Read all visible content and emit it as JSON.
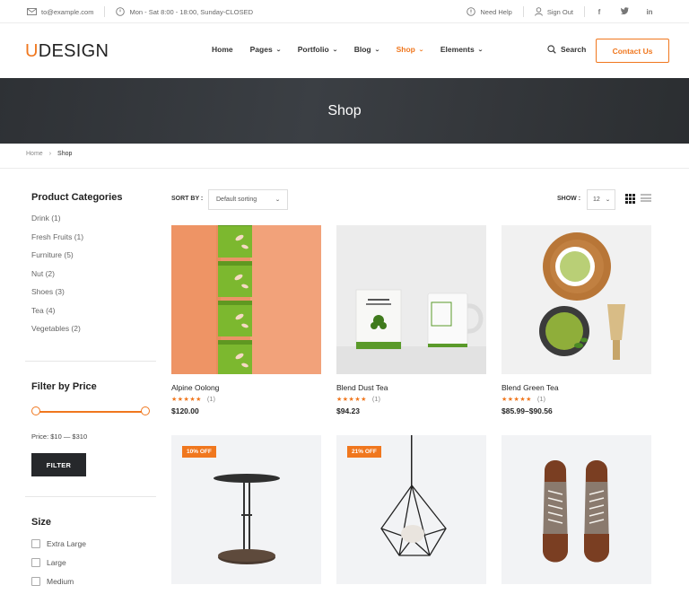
{
  "topbar": {
    "email": "to@example.com",
    "hours": "Mon - Sat 8:00 - 18:00, Sunday-CLOSED",
    "need_help": "Need Help",
    "sign_out": "Sign Out",
    "social": [
      "f",
      "t",
      "in"
    ]
  },
  "header": {
    "logo_u": "U",
    "logo_rest": "DESIGN",
    "nav": [
      "Home",
      "Pages",
      "Portfolio",
      "Blog",
      "Shop",
      "Elements"
    ],
    "search_label": "Search",
    "contact_label": "Contact Us"
  },
  "banner": {
    "title": "Shop"
  },
  "breadcrumb": {
    "home": "Home",
    "current": "Shop"
  },
  "sidebar": {
    "categories_title": "Product Categories",
    "categories": [
      "Drink (1)",
      "Fresh Fruits (1)",
      "Furniture (5)",
      "Nut (2)",
      "Shoes (3)",
      "Tea (4)",
      "Vegetables (2)"
    ],
    "price_title": "Filter by Price",
    "price_range": "Price: $10 — $310",
    "filter_label": "FILTER",
    "size_title": "Size",
    "sizes": [
      "Extra Large",
      "Large",
      "Medium"
    ]
  },
  "toolbar": {
    "sort_label": "SORT BY :",
    "sort_value": "Default sorting",
    "show_label": "SHOW :",
    "show_value": "12"
  },
  "products": [
    {
      "name": "Alpine Oolong",
      "stars": "★★★★★",
      "reviews": "(1)",
      "price": "$120.00"
    },
    {
      "name": "Blend Dust Tea",
      "stars": "★★★★★",
      "reviews": "(1)",
      "price": "$94.23"
    },
    {
      "name": "Blend Green Tea",
      "stars": "★★★★★",
      "reviews": "(1)",
      "price": "$85.99–$90.56"
    },
    {
      "badge": "10% OFF"
    },
    {
      "badge": "21% OFF"
    },
    {}
  ],
  "colors": {
    "accent": "#f0771e",
    "dark": "#26282b",
    "banner": "#35383c"
  }
}
